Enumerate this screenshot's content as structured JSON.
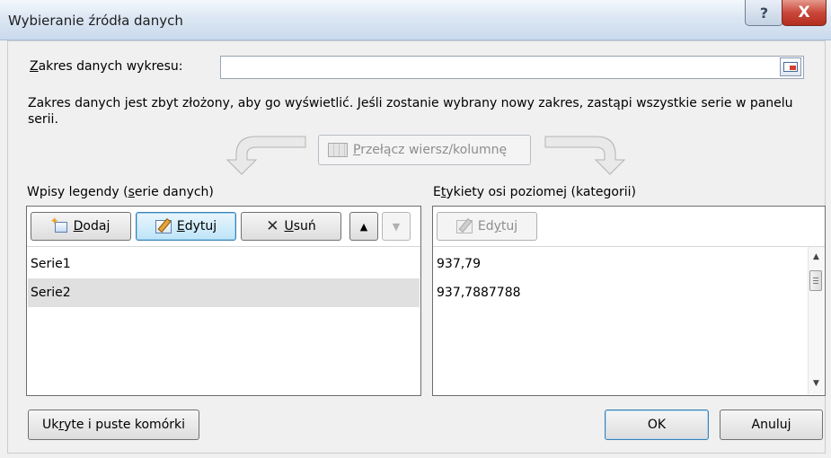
{
  "window": {
    "title": "Wybieranie źródła danych",
    "help_label": "?",
    "close_label": "X"
  },
  "range": {
    "label_accel": "Z",
    "label_rest": "akres danych wykresu:",
    "value": ""
  },
  "info_text": "Zakres danych jest zbyt złożony, aby go wyświetlić. Jeśli zostanie wybrany nowy zakres, zastąpi wszystkie serie w panelu serii.",
  "switch_button": {
    "accel": "P",
    "rest": "rzełącz wiersz/kolumnę"
  },
  "legend": {
    "label_pre": "Wpisy legendy (",
    "label_accel": "s",
    "label_post": "erie danych)",
    "add": {
      "accel": "D",
      "rest": "odaj"
    },
    "edit": {
      "accel": "E",
      "rest": "dytuj"
    },
    "remove": {
      "accel": "U",
      "rest": "suń"
    },
    "up_glyph": "▲",
    "down_glyph": "▼",
    "series": [
      {
        "label": "Serie1",
        "selected": false
      },
      {
        "label": "Serie2",
        "selected": true
      }
    ]
  },
  "axis": {
    "label_pre": "E",
    "label_accel": "t",
    "label_post": "ykiety osi poziomej (kategorii)",
    "edit": {
      "pre": "Ed",
      "accel": "y",
      "post": "tuj"
    },
    "categories": [
      "937,79",
      "937,7887788"
    ],
    "scroll_up": "▲",
    "scroll_down": "▼"
  },
  "hidden_cells": {
    "pre": "Uk",
    "accel": "r",
    "post": "yte i puste komórki"
  },
  "ok_label": "OK",
  "cancel_label": "Anuluj"
}
